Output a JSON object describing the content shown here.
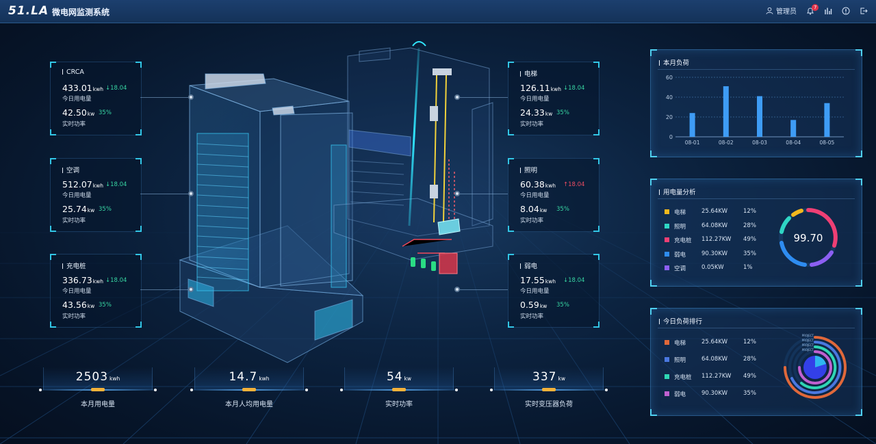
{
  "header": {
    "logo": "51.LA",
    "title": "微电网监测系统",
    "user": "管理员",
    "notification_count": "7"
  },
  "cards_left": [
    {
      "title": "CRCA",
      "energy": "433.01",
      "energy_unit": "kwh",
      "change": "↓18.04",
      "change_dir": "down",
      "energy_label": "今日用电量",
      "power": "42.50",
      "power_unit": "kw",
      "percent": "35%",
      "power_label": "实时功率"
    },
    {
      "title": "空调",
      "energy": "512.07",
      "energy_unit": "kwh",
      "change": "↓18.04",
      "change_dir": "down",
      "energy_label": "今日用电量",
      "power": "25.74",
      "power_unit": "kw",
      "percent": "35%",
      "power_label": "实时功率"
    },
    {
      "title": "充电桩",
      "energy": "336.73",
      "energy_unit": "kwh",
      "change": "↓18.04",
      "change_dir": "down",
      "energy_label": "今日用电量",
      "power": "43.56",
      "power_unit": "kw",
      "percent": "35%",
      "power_label": "实时功率"
    }
  ],
  "cards_right": [
    {
      "title": "电梯",
      "energy": "126.11",
      "energy_unit": "kwh",
      "change": "↓18.04",
      "change_dir": "down",
      "energy_label": "今日用电量",
      "power": "24.33",
      "power_unit": "kw",
      "percent": "35%",
      "power_label": "实时功率"
    },
    {
      "title": "照明",
      "energy": "60.38",
      "energy_unit": "kwh",
      "change": "↑18.04",
      "change_dir": "up",
      "energy_label": "今日用电量",
      "power": "8.04",
      "power_unit": "kw",
      "percent": "35%",
      "power_label": "实时功率"
    },
    {
      "title": "弱电",
      "energy": "17.55",
      "energy_unit": "kwh",
      "change": "↓18.04",
      "change_dir": "down",
      "energy_label": "今日用电量",
      "power": "0.59",
      "power_unit": "kw",
      "percent": "35%",
      "power_label": "实时功率"
    }
  ],
  "stats": [
    {
      "value": "2503",
      "unit": "kwh",
      "label": "本月用电量"
    },
    {
      "value": "14.7",
      "unit": "kwh",
      "label": "本月人均用电量"
    },
    {
      "value": "54",
      "unit": "kw",
      "label": "实时功率"
    },
    {
      "value": "337",
      "unit": "kw",
      "label": "实时变压器负荷"
    }
  ],
  "load_panel": {
    "title": "本月负荷"
  },
  "analysis_panel": {
    "title": "用电量分析",
    "gauge_value": "99.70",
    "rows": [
      {
        "name": "电梯",
        "kw": "25.64KW",
        "pct": "12%",
        "color": "#f2b81d"
      },
      {
        "name": "照明",
        "kw": "64.08KW",
        "pct": "28%",
        "color": "#2fd6c4"
      },
      {
        "name": "充电桩",
        "kw": "112.27KW",
        "pct": "49%",
        "color": "#ef3f74"
      },
      {
        "name": "弱电",
        "kw": "90.30KW",
        "pct": "35%",
        "color": "#2e8cf0"
      },
      {
        "name": "空调",
        "kw": "0.05KW",
        "pct": "1%",
        "color": "#8c5ff2"
      }
    ]
  },
  "ranking_panel": {
    "title": "今日负荷排行",
    "ring_labels": [
      "PROJECT",
      "PROJECT",
      "PROJECT",
      "PROJECT"
    ],
    "rows": [
      {
        "name": "电梯",
        "kw": "25.64KW",
        "pct": "12%",
        "color": "#e0683a"
      },
      {
        "name": "照明",
        "kw": "64.08KW",
        "pct": "28%",
        "color": "#4a78e0"
      },
      {
        "name": "充电桩",
        "kw": "112.27KW",
        "pct": "49%",
        "color": "#2fd6b4"
      },
      {
        "name": "弱电",
        "kw": "90.30KW",
        "pct": "35%",
        "color": "#c060d0"
      }
    ]
  },
  "chart_data": {
    "type": "bar",
    "categories": [
      "08-01",
      "08-02",
      "08-03",
      "08-04",
      "08-05"
    ],
    "values": [
      24,
      51,
      41,
      17,
      34
    ],
    "ylim": [
      0,
      60
    ],
    "yticks": [
      0,
      20,
      40,
      60
    ],
    "title": "本月负荷",
    "bar_color": "#3e9cf5",
    "grid": true
  }
}
